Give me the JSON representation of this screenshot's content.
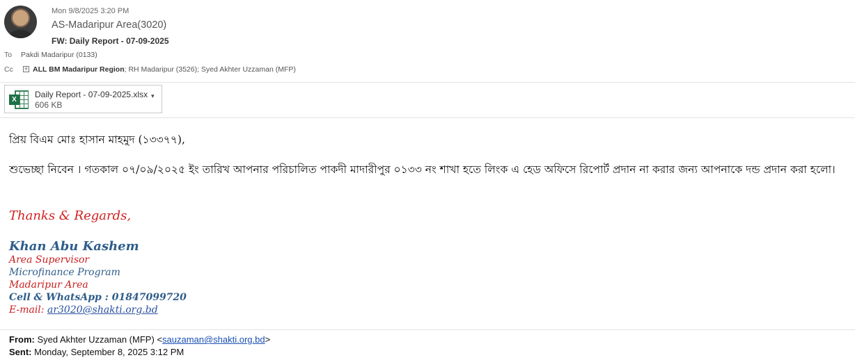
{
  "header": {
    "date": "Mon 9/8/2025 3:20 PM",
    "sender": "AS-Madaripur Area(3020)",
    "subject": "FW: Daily Report - 07-09-2025"
  },
  "recipients": {
    "to_label": "To",
    "to": "Pakdi Madaripur (0133)",
    "cc_label": "Cc",
    "cc_group": "ALL BM Madaripur Region",
    "cc_rest": "; RH Madaripur (3526); Syed Akhter Uzzaman (MFP)"
  },
  "attachment": {
    "name": "Daily Report - 07-09-2025.xlsx",
    "size": "606 KB",
    "icon": "excel-file-icon",
    "badge": "X"
  },
  "body": {
    "greeting": "প্রিয় বিএম মোঃ হাসান মাহমুদ (১৩৩৭৭),",
    "paragraph": "শুভেচ্ছা নিবেন । গতকাল ০৭/০৯/২০২৫ ইং তারিখ আপনার পরিচালিত পাকদী মাদারীপুর ০১৩৩ নং শাখা হতে লিংক এ হেড অফিসে রিপোর্ট প্রদান না করার জন্য আপনাকে দন্ড প্রদান করা হলো।"
  },
  "signature": {
    "thanks": "Thanks & Regards,",
    "name": "Khan Abu Kashem",
    "title": "Area Supervisor",
    "program": "Microfinance Program",
    "area": "Madaripur Area",
    "cell": "Cell  & WhatsApp : 01847099720",
    "email_label": "E-mail: ",
    "email": "ar3020@shakti.org.bd"
  },
  "forwarded": {
    "from_label": "From:",
    "from_name": " Syed Akhter Uzzaman (MFP) <",
    "from_email": "sauzaman@shakti.org.bd",
    "from_close": ">",
    "sent_label": "Sent:",
    "sent": " Monday, September 8, 2025 3:12 PM"
  },
  "colors": {
    "signature_red": "#d21f1f",
    "signature_blue": "#2e5d8a",
    "excel_green": "#1e7145"
  }
}
